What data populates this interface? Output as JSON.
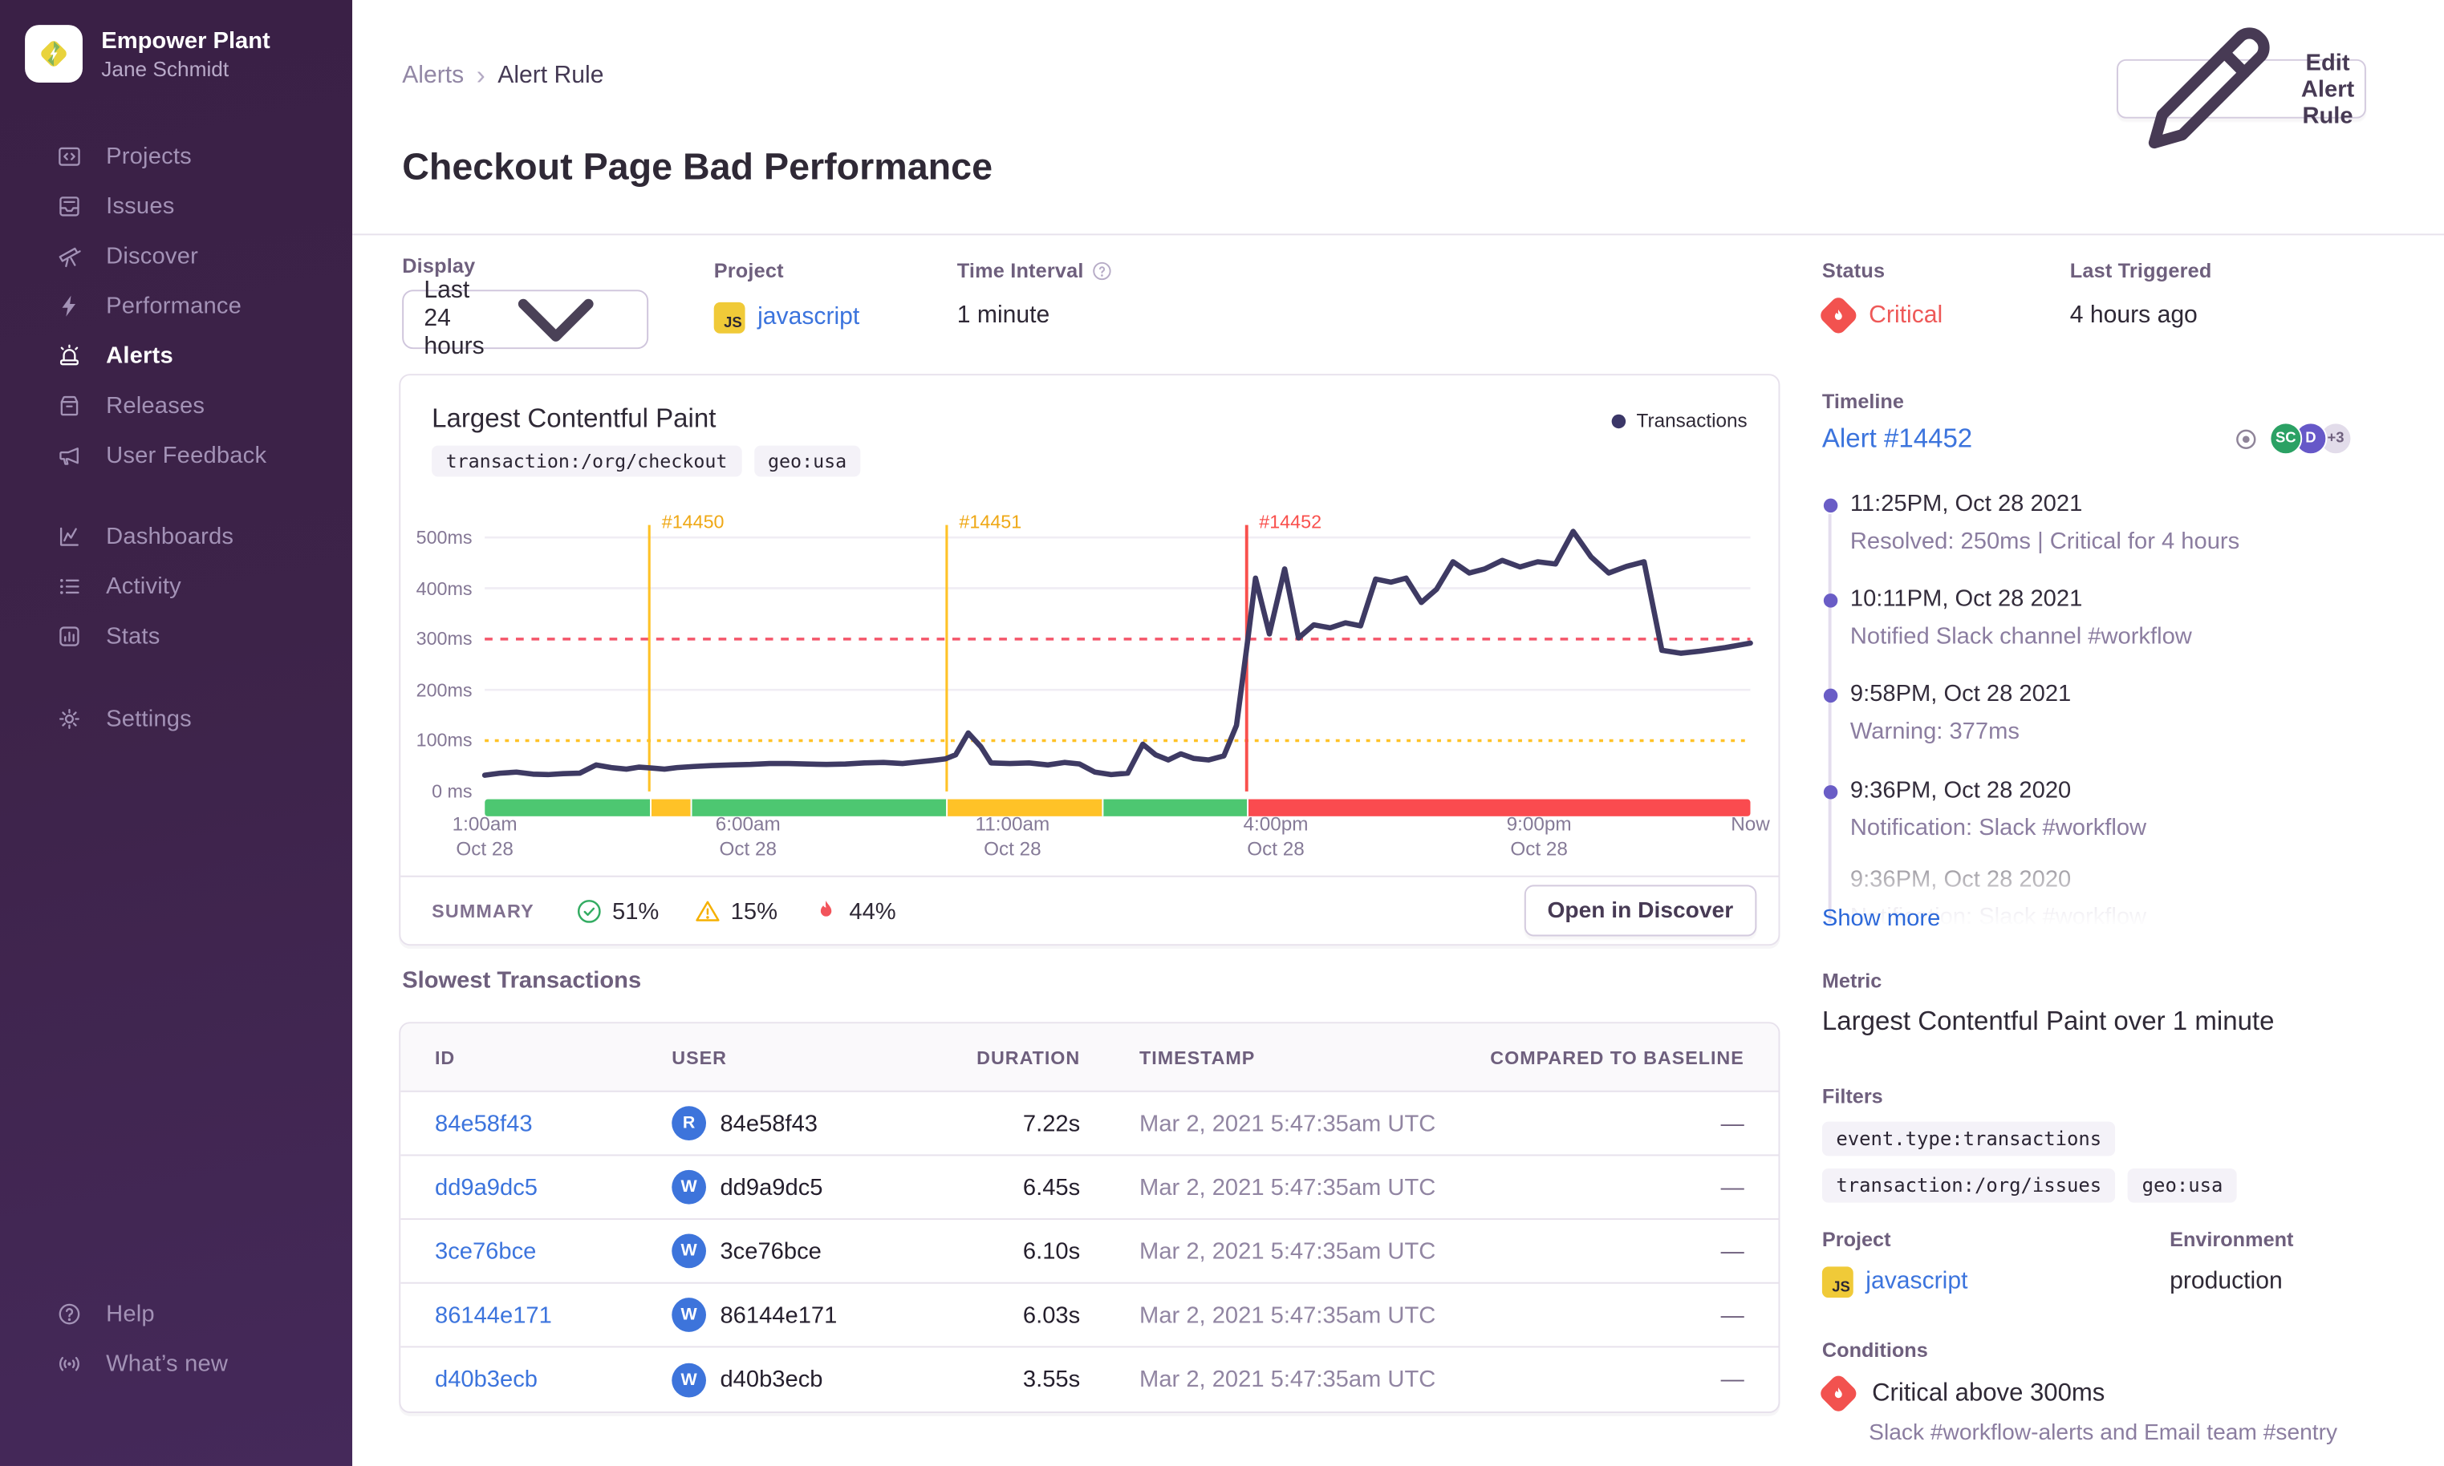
{
  "org": {
    "name": "Empower Plant",
    "user": "Jane Schmidt"
  },
  "sidebar": {
    "primary": [
      {
        "label": "Projects",
        "icon": "projects",
        "active": false
      },
      {
        "label": "Issues",
        "icon": "issues",
        "active": false
      },
      {
        "label": "Discover",
        "icon": "discover",
        "active": false
      },
      {
        "label": "Performance",
        "icon": "performance",
        "active": false
      },
      {
        "label": "Alerts",
        "icon": "alerts",
        "active": true
      },
      {
        "label": "Releases",
        "icon": "releases",
        "active": false
      },
      {
        "label": "User Feedback",
        "icon": "user-feedback",
        "active": false
      }
    ],
    "secondary": [
      {
        "label": "Dashboards",
        "icon": "dashboards",
        "active": false
      },
      {
        "label": "Activity",
        "icon": "activity",
        "active": false
      },
      {
        "label": "Stats",
        "icon": "stats",
        "active": false
      }
    ],
    "tertiary": [
      {
        "label": "Settings",
        "icon": "settings",
        "active": false
      }
    ],
    "footer": [
      {
        "label": "Help",
        "icon": "help",
        "active": false
      },
      {
        "label": "What’s new",
        "icon": "whats-new",
        "active": false
      }
    ]
  },
  "header": {
    "breadcrumb_parent": "Alerts",
    "breadcrumb_current": "Alert Rule",
    "title": "Checkout Page Bad Performance",
    "edit_button": "Edit Alert Rule"
  },
  "meta": {
    "display_label": "Display",
    "display_value": "Last 24 hours",
    "project_label": "Project",
    "project_value": "javascript",
    "project_badge": "JS",
    "interval_label": "Time Interval",
    "interval_value": "1 minute",
    "status_label": "Status",
    "status_value": "Critical",
    "last_triggered_label": "Last Triggered",
    "last_triggered_value": "4 hours ago"
  },
  "chart": {
    "title": "Largest Contentful Paint",
    "tags": [
      "transaction:/org/checkout",
      "geo:usa"
    ],
    "legend": "Transactions",
    "summary_label": "SUMMARY",
    "summary": [
      {
        "icon": "check-circle",
        "value": "51%",
        "color": "#33ac62"
      },
      {
        "icon": "warning-triangle",
        "value": "15%",
        "color": "#f5b000"
      },
      {
        "icon": "flame",
        "value": "44%",
        "color": "#f2545b"
      }
    ],
    "open_button": "Open in Discover"
  },
  "chart_data": {
    "type": "line",
    "title": "Largest Contentful Paint",
    "unit": "ms",
    "ylim": [
      0,
      530
    ],
    "grid": true,
    "legend_position": "top-right",
    "y_ticks": [
      {
        "label": "500ms",
        "value": 500
      },
      {
        "label": "400ms",
        "value": 400
      },
      {
        "label": "300ms",
        "value": 300
      },
      {
        "label": "200ms",
        "value": 200
      },
      {
        "label": "100ms",
        "value": 100
      },
      {
        "label": "0 ms",
        "value": 0
      }
    ],
    "x_ticks": [
      {
        "label": "1:00am",
        "sub": "Oct 28",
        "pos": 0
      },
      {
        "label": "6:00am",
        "sub": "Oct 28",
        "pos": 20.8
      },
      {
        "label": "11:00am",
        "sub": "Oct 28",
        "pos": 41.7
      },
      {
        "label": "4:00pm",
        "sub": "Oct 28",
        "pos": 62.5
      },
      {
        "label": "9:00pm",
        "sub": "Oct 28",
        "pos": 83.3
      },
      {
        "label": "Now",
        "sub": "",
        "pos": 100
      }
    ],
    "thresholds": [
      {
        "name": "critical",
        "value": 300
      },
      {
        "name": "warning",
        "value": 100
      }
    ],
    "incidents": [
      {
        "id": "#14450",
        "pos": 13,
        "severity": "warning"
      },
      {
        "id": "#14451",
        "pos": 36.5,
        "severity": "warning"
      },
      {
        "id": "#14452",
        "pos": 60.2,
        "severity": "critical"
      }
    ],
    "status_segments": [
      {
        "from": 0,
        "to": 13,
        "status": "good"
      },
      {
        "from": 13,
        "to": 16.2,
        "status": "warning"
      },
      {
        "from": 16.2,
        "to": 36.5,
        "status": "good"
      },
      {
        "from": 36.5,
        "to": 48.8,
        "status": "warning"
      },
      {
        "from": 48.8,
        "to": 60.2,
        "status": "good"
      },
      {
        "from": 60.2,
        "to": 100,
        "status": "critical"
      }
    ],
    "colors": {
      "line": "#3e3a63",
      "grid": "#f0edf4",
      "warning": "#ffc227",
      "critical": "#f9504d",
      "good": "#4dc771",
      "warning_bar": "#ffc227",
      "critical_bar": "#fa4b4f"
    },
    "series": [
      {
        "name": "Transactions",
        "points": [
          [
            0,
            32
          ],
          [
            1.2,
            36
          ],
          [
            2.5,
            38
          ],
          [
            3.8,
            34
          ],
          [
            5,
            33
          ],
          [
            6.2,
            35
          ],
          [
            7.5,
            36
          ],
          [
            8.8,
            52
          ],
          [
            10,
            47
          ],
          [
            11.2,
            44
          ],
          [
            12.2,
            48
          ],
          [
            13.2,
            46
          ],
          [
            14.2,
            44
          ],
          [
            15.2,
            47
          ],
          [
            16.5,
            49
          ],
          [
            18,
            51
          ],
          [
            19.5,
            52
          ],
          [
            21,
            53
          ],
          [
            22.5,
            55
          ],
          [
            24,
            55
          ],
          [
            25.5,
            54
          ],
          [
            27,
            53
          ],
          [
            28.5,
            54
          ],
          [
            30,
            56
          ],
          [
            31.5,
            57
          ],
          [
            33,
            55
          ],
          [
            34.2,
            58
          ],
          [
            35.4,
            61
          ],
          [
            36.4,
            64
          ],
          [
            37.2,
            72
          ],
          [
            38.2,
            115
          ],
          [
            39.2,
            88
          ],
          [
            40,
            56
          ],
          [
            41.5,
            55
          ],
          [
            43,
            56
          ],
          [
            44.5,
            52
          ],
          [
            45.8,
            57
          ],
          [
            47,
            54
          ],
          [
            48.2,
            38
          ],
          [
            49.5,
            33
          ],
          [
            50.8,
            36
          ],
          [
            52,
            93
          ],
          [
            53,
            72
          ],
          [
            54,
            62
          ],
          [
            55,
            74
          ],
          [
            56,
            65
          ],
          [
            57.2,
            62
          ],
          [
            58.4,
            70
          ],
          [
            59.4,
            130
          ],
          [
            60.3,
            300
          ],
          [
            60.9,
            420
          ],
          [
            62,
            310
          ],
          [
            63.2,
            438
          ],
          [
            64.3,
            302
          ],
          [
            65.5,
            328
          ],
          [
            66.8,
            322
          ],
          [
            68,
            332
          ],
          [
            69.2,
            326
          ],
          [
            70.4,
            418
          ],
          [
            71.6,
            412
          ],
          [
            72.8,
            420
          ],
          [
            74,
            372
          ],
          [
            75.2,
            398
          ],
          [
            76.5,
            452
          ],
          [
            77.8,
            430
          ],
          [
            79,
            438
          ],
          [
            80.4,
            455
          ],
          [
            81.8,
            442
          ],
          [
            83.2,
            452
          ],
          [
            84.6,
            448
          ],
          [
            86,
            512
          ],
          [
            87.4,
            462
          ],
          [
            88.8,
            430
          ],
          [
            90.2,
            443
          ],
          [
            91.6,
            452
          ],
          [
            93,
            278
          ],
          [
            94.5,
            272
          ],
          [
            96,
            276
          ],
          [
            98,
            283
          ],
          [
            100,
            292
          ]
        ]
      }
    ]
  },
  "transactions": {
    "title": "Slowest Transactions",
    "columns": [
      "ID",
      "USER",
      "DURATION",
      "TIMESTAMP",
      "COMPARED TO BASELINE"
    ],
    "rows": [
      {
        "id": "84e58f43",
        "avatar": "R",
        "user": "84e58f43",
        "duration": "7.22s",
        "timestamp": "Mar 2, 2021 5:47:35am UTC",
        "baseline": "—"
      },
      {
        "id": "dd9a9dc5",
        "avatar": "W",
        "user": "dd9a9dc5",
        "duration": "6.45s",
        "timestamp": "Mar 2, 2021 5:47:35am UTC",
        "baseline": "—"
      },
      {
        "id": "3ce76bce",
        "avatar": "W",
        "user": "3ce76bce",
        "duration": "6.10s",
        "timestamp": "Mar 2, 2021 5:47:35am UTC",
        "baseline": "—"
      },
      {
        "id": "86144e171",
        "avatar": "W",
        "user": "86144e171",
        "duration": "6.03s",
        "timestamp": "Mar 2, 2021 5:47:35am UTC",
        "baseline": "—"
      },
      {
        "id": "d40b3ecb",
        "avatar": "W",
        "user": "d40b3ecb",
        "duration": "3.55s",
        "timestamp": "Mar 2, 2021 5:47:35am UTC",
        "baseline": "—"
      }
    ]
  },
  "timeline": {
    "label": "Timeline",
    "alert_link": "Alert #14452",
    "avatars": [
      {
        "text": "SC",
        "color": "#2ba164",
        "text_color": "#ffffff"
      },
      {
        "text": "D",
        "color": "#6658c8",
        "text_color": "#ffffff"
      },
      {
        "text": "+3",
        "color": "#e2dcea",
        "text_color": "#6e5f7d"
      }
    ],
    "entries": [
      {
        "time": "11:25PM, Oct 28 2021",
        "desc": "Resolved: 250ms | Critical for 4 hours",
        "faded": false
      },
      {
        "time": "10:11PM, Oct 28 2021",
        "desc": "Notified Slack channel #workflow",
        "faded": false
      },
      {
        "time": "9:58PM, Oct 28 2021",
        "desc": "Warning: 377ms",
        "faded": false
      },
      {
        "time": "9:36PM, Oct 28 2020",
        "desc": "Notification: Slack #workflow",
        "faded": false
      },
      {
        "time": "9:36PM, Oct 28 2020",
        "desc": "Notification: Slack #workflow",
        "faded": true
      }
    ],
    "show_more": "Show more"
  },
  "details": {
    "metric_label": "Metric",
    "metric_value": "Largest Contentful Paint over 1 minute",
    "filters_label": "Filters",
    "filters": [
      "event.type:transactions",
      "transaction:/org/issues",
      "geo:usa"
    ],
    "project_label": "Project",
    "project_value": "javascript",
    "project_badge": "JS",
    "environment_label": "Environment",
    "environment_value": "production",
    "conditions_label": "Conditions",
    "condition_title": "Critical above 300ms",
    "condition_desc": "Slack #workflow-alerts and Email team #sentry"
  }
}
